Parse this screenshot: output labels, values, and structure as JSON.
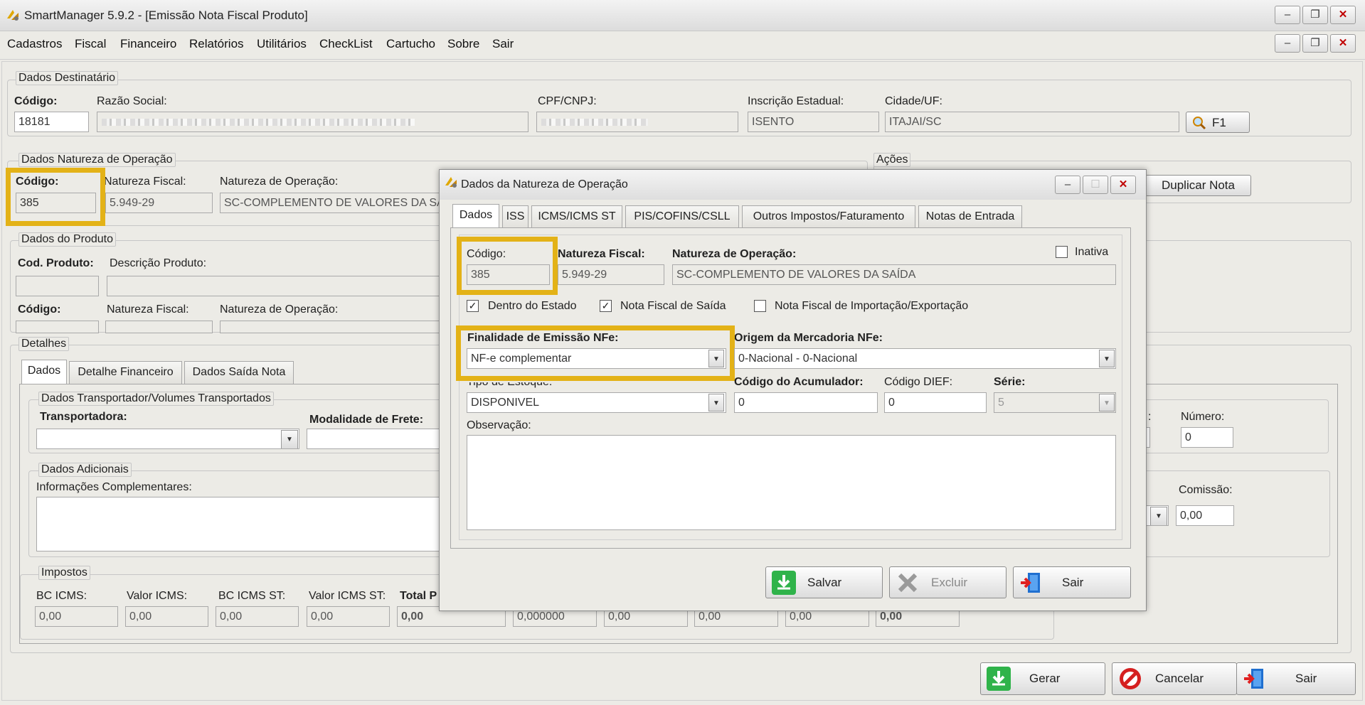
{
  "window": {
    "title": "SmartManager 5.9.2 - [Emissão Nota Fiscal Produto]"
  },
  "menu": [
    "Cadastros",
    "Fiscal",
    "Financeiro",
    "Relatórios",
    "Utilitários",
    "CheckList",
    "Cartucho",
    "Sobre",
    "Sair"
  ],
  "colors": {
    "highlight": "#e3b217",
    "accent_green": "#2fb34a",
    "cancel_red": "#d51f1f"
  },
  "destinatario": {
    "group": "Dados Destinatário",
    "codigo_label": "Código:",
    "codigo": "18181",
    "razao_label": "Razão Social:",
    "cpf_label": "CPF/CNPJ:",
    "ie_label": "Inscrição Estadual:",
    "ie": "ISENTO",
    "cidade_label": "Cidade/UF:",
    "cidade": "ITAJAI/SC",
    "f1_label": "F1"
  },
  "natureza": {
    "group": "Dados Natureza de Operação",
    "codigo_label": "Código:",
    "codigo": "385",
    "fiscal_label": "Natureza Fiscal:",
    "fiscal": "5.949-29",
    "operacao_label": "Natureza de Operação:",
    "operacao": "SC-COMPLEMENTO DE VALORES DA SA"
  },
  "acoes": {
    "group": "Ações",
    "duplicar": "Duplicar Nota"
  },
  "produto": {
    "group": "Dados do Produto",
    "cod_label": "Cod. Produto:",
    "desc_label": "Descrição Produto:",
    "codigo_label": "Código:",
    "fiscal_label": "Natureza Fiscal:",
    "operacao_label": "Natureza de Operação:"
  },
  "detalhes": {
    "group": "Detalhes",
    "tabs": [
      "Dados",
      "Detalhe Financeiro",
      "Dados Saída Nota"
    ],
    "transp_group": "Dados Transportador/Volumes Transportados",
    "transportadora_label": "Transportadora:",
    "modalidade_label": "Modalidade de Frete:",
    "numero_label": "Número:",
    "numero": "0",
    "colon": ":",
    "adicionais_group": "Dados Adicionais",
    "info_label": "Informações Complementares:",
    "comissao_label": "Comissão:",
    "comissao": "0,00",
    "impostos_group": "Impostos",
    "bc_icms_label": "BC ICMS:",
    "valor_icms_label": "Valor ICMS:",
    "bc_icms_st_label": "BC ICMS ST:",
    "valor_icms_st_label": "Valor ICMS ST:",
    "total_label": "Total P",
    "bc_icms": "0,00",
    "valor_icms": "0,00",
    "bc_icms_st": "0,00",
    "valor_icms_st": "0,00",
    "total": "0,00",
    "v6": "0,000000",
    "v7": "0,00",
    "v8": "0,00",
    "v9": "0,00",
    "v10": "0,00"
  },
  "footer": {
    "gerar": "Gerar",
    "cancelar": "Cancelar",
    "sair": "Sair"
  },
  "modal": {
    "title": "Dados da Natureza de Operação",
    "tabs": [
      "Dados",
      "ISS",
      "ICMS/ICMS ST",
      "PIS/COFINS/CSLL",
      "Outros Impostos/Faturamento",
      "Notas de Entrada"
    ],
    "codigo_label": "Código:",
    "codigo": "385",
    "fiscal_label": "Natureza Fiscal:",
    "fiscal": "5.949-29",
    "operacao_label": "Natureza de Operação:",
    "operacao": "SC-COMPLEMENTO DE VALORES DA SAÍDA",
    "inativa_label": "Inativa",
    "inativa": false,
    "dentro_label": "Dentro do Estado",
    "dentro": true,
    "saida_label": "Nota Fiscal de Saída",
    "saida": true,
    "import_label": "Nota Fiscal de Importação/Exportação",
    "import": false,
    "finalidade_label": "Finalidade de Emissão NFe:",
    "finalidade": "NF-e complementar",
    "origem_label": "Origem da Mercadoria NFe:",
    "origem": "0-Nacional - 0-Nacional",
    "estoque_label": "Tipo de Estoque:",
    "estoque": "DISPONIVEL",
    "acumulador_label": "Código do Acumulador:",
    "acumulador": "0",
    "dief_label": "Código DIEF:",
    "dief": "0",
    "serie_label": "Série:",
    "serie": "5",
    "obs_label": "Observação:",
    "salvar": "Salvar",
    "excluir": "Excluir",
    "sair": "Sair"
  }
}
